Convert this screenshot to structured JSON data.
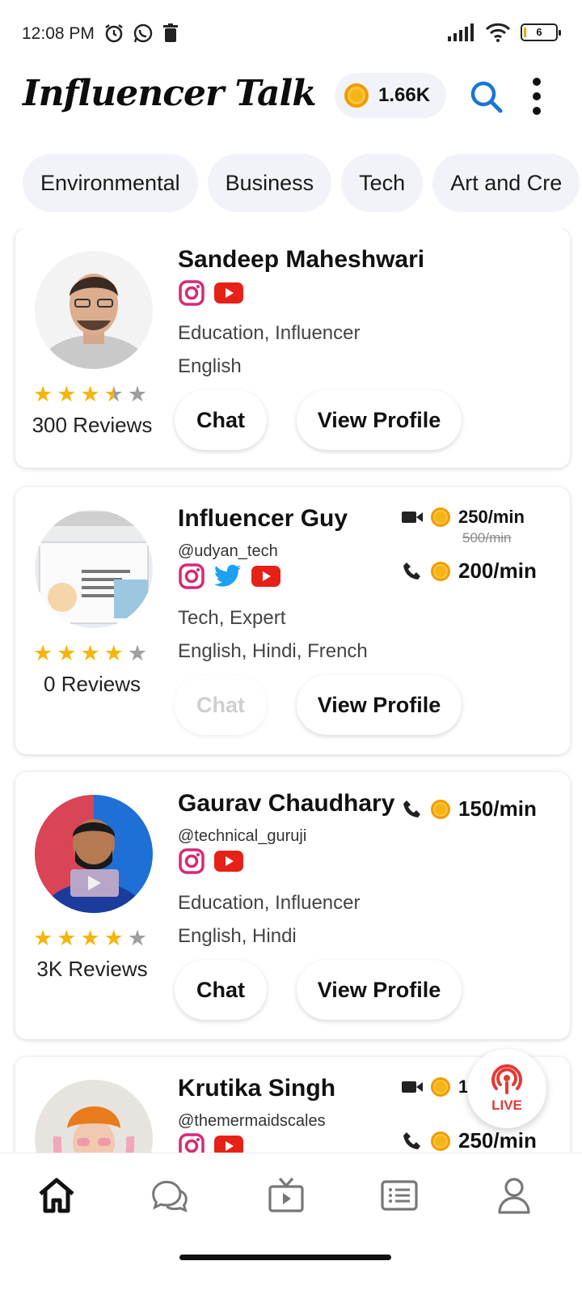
{
  "status_bar": {
    "time": "12:08 PM",
    "battery": "6"
  },
  "header": {
    "title": "Influencer Talk",
    "coins": "1.66K"
  },
  "categories": [
    "Environmental",
    "Business",
    "Tech",
    "Art and Cre"
  ],
  "influencers": [
    {
      "name": "Sandeep Maheshwari",
      "categories": "Education, Influencer",
      "languages": "English",
      "rating": 3.5,
      "reviews": "300 Reviews",
      "chat_label": "Chat",
      "profile_label": "View Profile"
    },
    {
      "name": "Influencer Guy",
      "handle": "@udyan_tech",
      "categories": "Tech, Expert",
      "languages": "English, Hindi, French",
      "rating": 4,
      "reviews": "0 Reviews",
      "video_rate": "250/min",
      "video_old_rate": "500/min",
      "call_rate": "200/min",
      "chat_label": "Chat",
      "profile_label": "View Profile"
    },
    {
      "name": "Gaurav Chaudhary",
      "handle": "@technical_guruji",
      "categories": "Education, Influencer",
      "languages": "English, Hindi",
      "rating": 4,
      "reviews": "3K Reviews",
      "call_rate": "150/min",
      "chat_label": "Chat",
      "profile_label": "View Profile"
    },
    {
      "name": "Krutika Singh",
      "handle": "@themermaidscales",
      "video_rate_partial": "15",
      "call_rate": "250/min"
    }
  ],
  "live_button": {
    "label": "LIVE"
  },
  "bottom_nav": [
    "home-icon",
    "chat-icon",
    "tv-icon",
    "list-icon",
    "profile-icon"
  ]
}
